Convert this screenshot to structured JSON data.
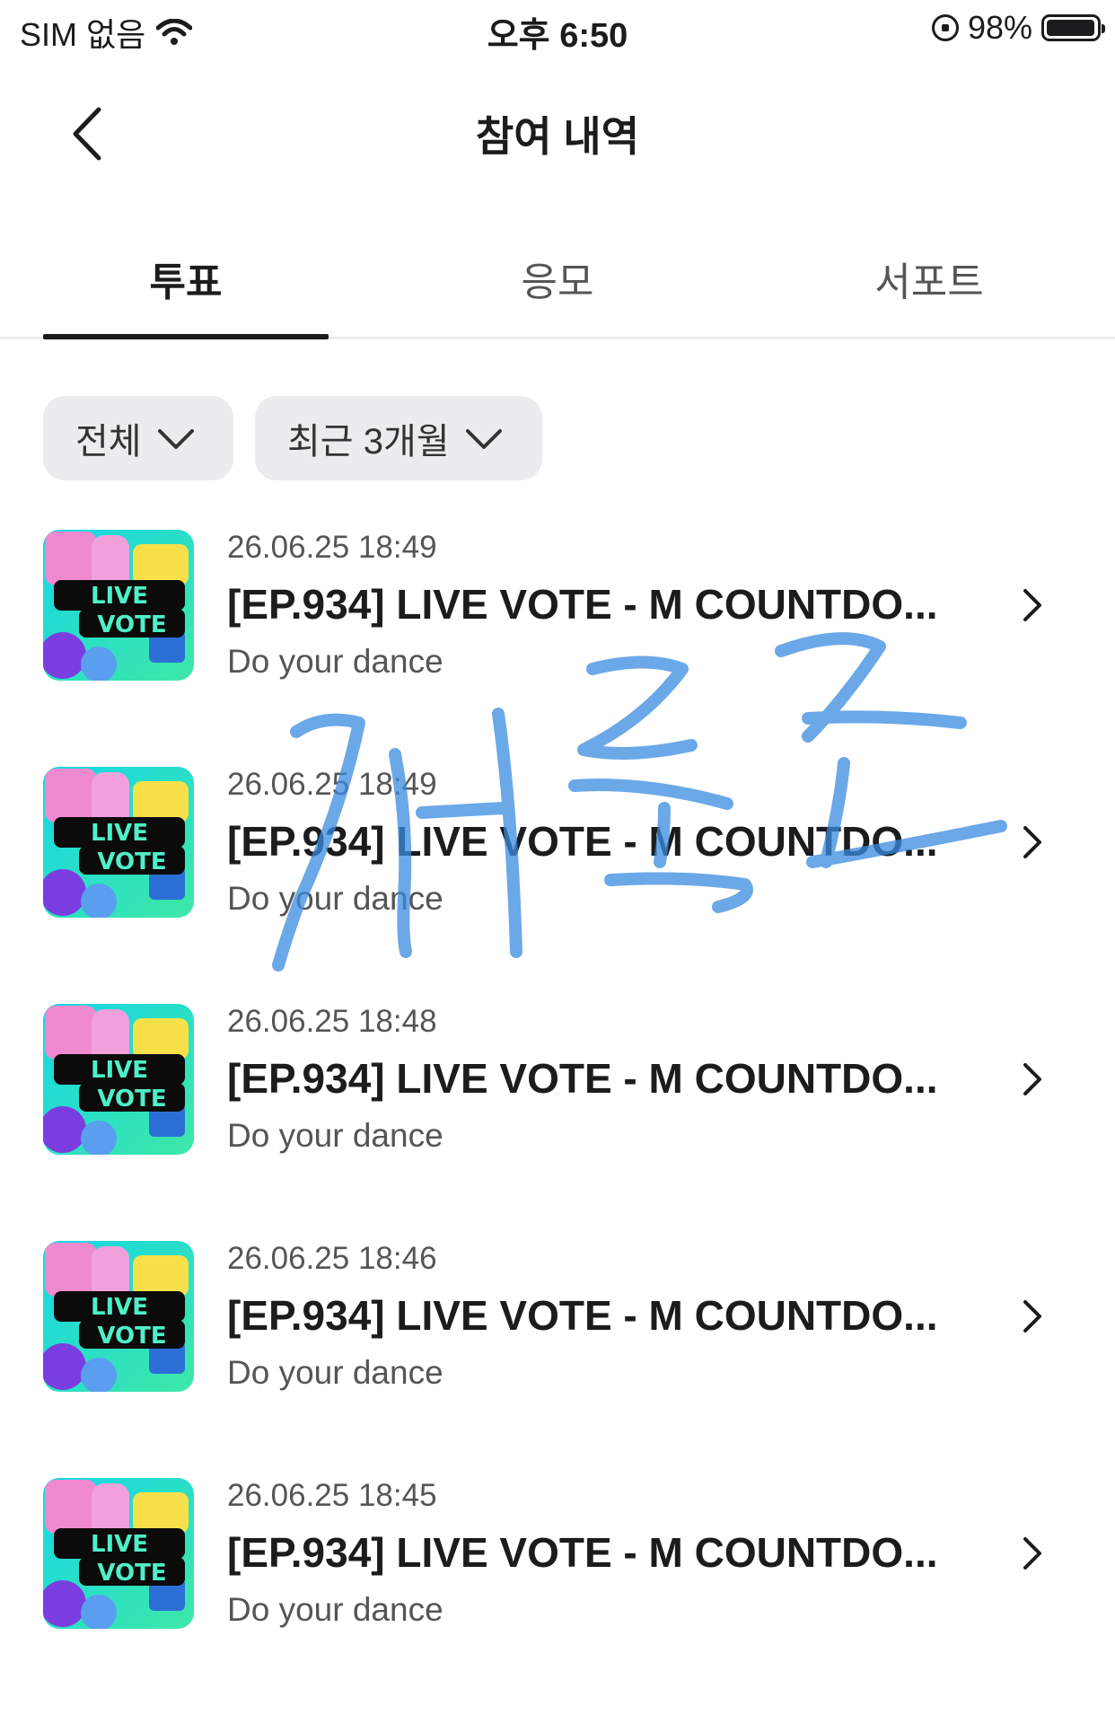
{
  "status_bar": {
    "carrier": "SIM 없음",
    "time": "오후 6:50",
    "battery_percent_label": "98%",
    "battery_level": 0.98
  },
  "nav": {
    "title": "참여 내역",
    "back_icon": "chevron-left-icon"
  },
  "tabs": [
    {
      "label": "투표",
      "active": true
    },
    {
      "label": "응모",
      "active": false
    },
    {
      "label": "서포트",
      "active": false
    }
  ],
  "filters": [
    {
      "label": "전체",
      "icon": "chevron-down-icon"
    },
    {
      "label": "최근 3개월",
      "icon": "chevron-down-icon"
    }
  ],
  "items": [
    {
      "date": "26.06.25 18:49",
      "title": "[EP.934] LIVE VOTE - M COUNTDO...",
      "subtitle": "Do your dance",
      "thumb_text": [
        "LIVE",
        "VOTE"
      ]
    },
    {
      "date": "26.06.25 18:49",
      "title": "[EP.934] LIVE VOTE - M COUNTDO...",
      "subtitle": "Do your dance",
      "thumb_text": [
        "LIVE",
        "VOTE"
      ]
    },
    {
      "date": "26.06.25 18:48",
      "title": "[EP.934] LIVE VOTE - M COUNTDO...",
      "subtitle": "Do your dance",
      "thumb_text": [
        "LIVE",
        "VOTE"
      ]
    },
    {
      "date": "26.06.25 18:46",
      "title": "[EP.934] LIVE VOTE - M COUNTDO...",
      "subtitle": "Do your dance",
      "thumb_text": [
        "LIVE",
        "VOTE"
      ]
    },
    {
      "date": "26.06.25 18:45",
      "title": "[EP.934] LIVE VOTE - M COUNTDO...",
      "subtitle": "Do your dance",
      "thumb_text": [
        "LIVE",
        "VOTE"
      ]
    }
  ],
  "colors": {
    "text_primary": "#1c1c1e",
    "text_secondary": "#555555",
    "chip_bg": "#ececee",
    "scribble": "#3a8be0"
  }
}
